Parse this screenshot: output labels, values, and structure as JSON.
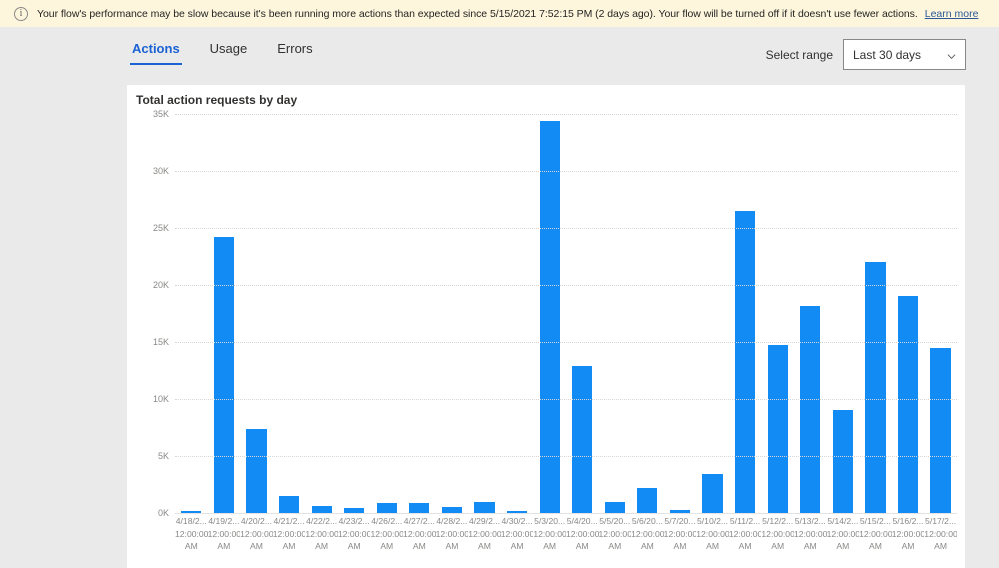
{
  "banner": {
    "icon": "info-circle-icon",
    "message": "Your flow's performance may be slow because it's been running more actions than expected since 5/15/2021 7:52:15 PM (2 days ago). Your flow will be turned off if it doesn't use fewer actions.",
    "link_label": "Learn more",
    "background_color": "#fdf6dd"
  },
  "tabs": [
    {
      "label": "Actions",
      "active": true
    },
    {
      "label": "Usage",
      "active": false
    },
    {
      "label": "Errors",
      "active": false
    }
  ],
  "range_picker": {
    "label": "Select range",
    "selected": "Last 30 days",
    "chevron_icon": "chevron-down-icon",
    "options": [
      "Last 30 days"
    ]
  },
  "accent_color": "#1b62d4",
  "bar_color": "#128bf5",
  "chart_data": {
    "type": "bar",
    "title": "Total action requests by day",
    "xlabel": "",
    "ylabel": "",
    "ylim": [
      0,
      35000
    ],
    "ytick_labels": [
      "35K",
      "30K",
      "25K",
      "20K",
      "15K",
      "10K",
      "5K",
      "0K"
    ],
    "ytick_values": [
      35000,
      30000,
      25000,
      20000,
      15000,
      10000,
      5000,
      0
    ],
    "grid": true,
    "legend": "none",
    "categories": [
      "4/18/2... 12:00:00 AM",
      "4/19/2... 12:00:00 AM",
      "4/20/2... 12:00:00 AM",
      "4/21/2... 12:00:00 AM",
      "4/22/2... 12:00:00 AM",
      "4/23/2... 12:00:00 AM",
      "4/26/2... 12:00:00 AM",
      "4/27/2... 12:00:00 AM",
      "4/28/2... 12:00:00 AM",
      "4/29/2... 12:00:00 AM",
      "4/30/2... 12:00:00 AM",
      "5/3/20... 12:00:00 AM",
      "5/4/20... 12:00:00 AM",
      "5/5/20... 12:00:00 AM",
      "5/6/20... 12:00:00 AM",
      "5/7/20... 12:00:00 AM",
      "5/10/2... 12:00:00 AM",
      "5/11/2... 12:00:00 AM",
      "5/12/2... 12:00:00 AM",
      "5/13/2... 12:00:00 AM",
      "5/14/2... 12:00:00 AM",
      "5/15/2... 12:00:00 AM",
      "5/16/2... 12:00:00 AM",
      "5/17/2... 12:00:00 AM"
    ],
    "values": [
      200,
      24200,
      7400,
      1500,
      600,
      400,
      900,
      900,
      500,
      1000,
      200,
      34400,
      12900,
      1000,
      2200,
      300,
      3400,
      26500,
      14700,
      18200,
      9000,
      22000,
      19000,
      14500
    ]
  }
}
